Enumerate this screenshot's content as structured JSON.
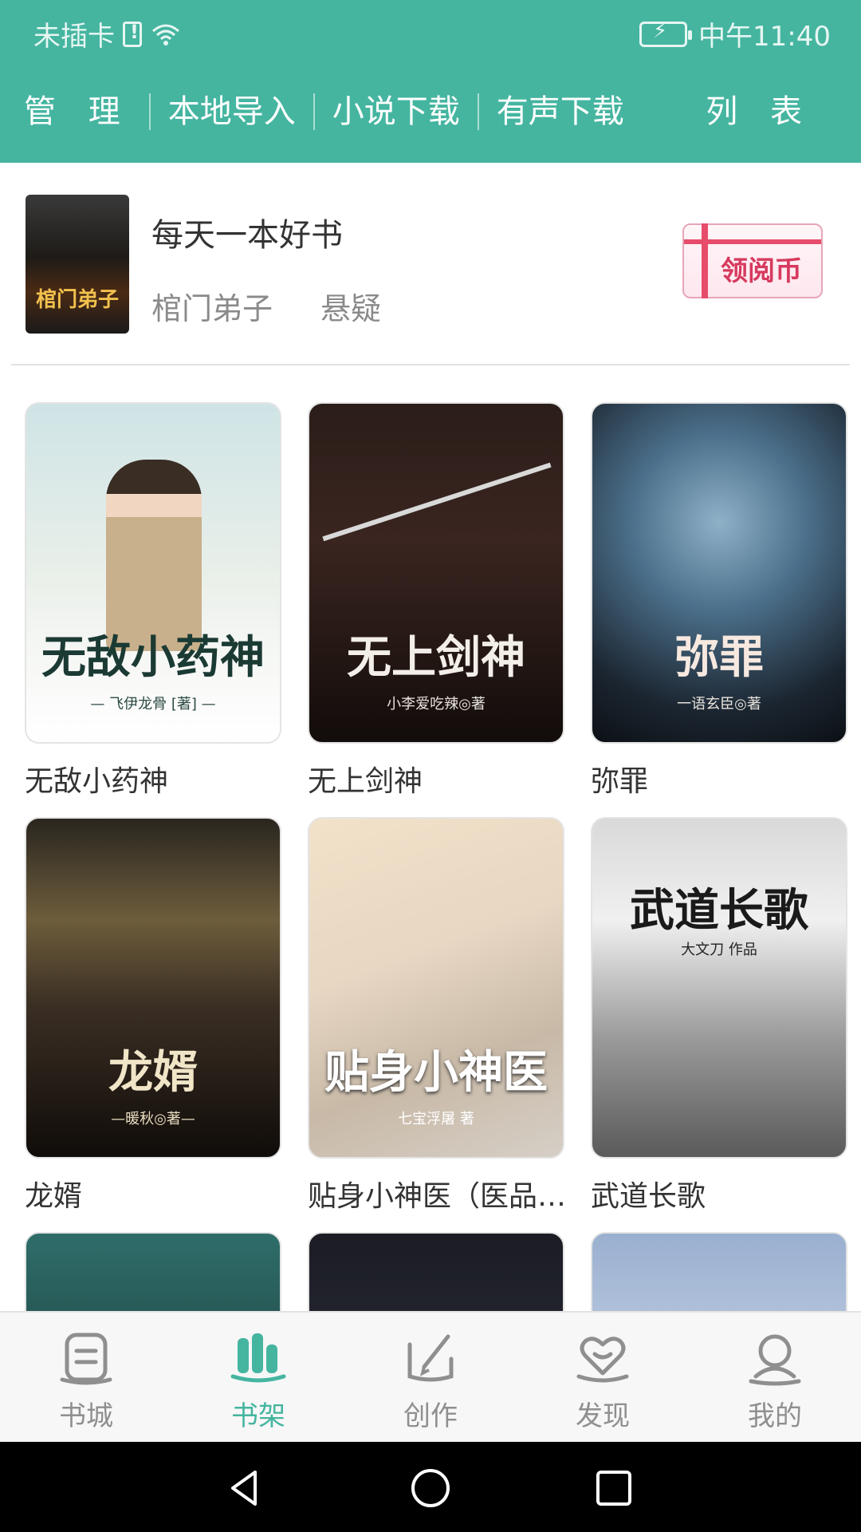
{
  "status_bar": {
    "carrier": "未插卡",
    "time": "中午11:40"
  },
  "top_nav": {
    "items": [
      "管 理",
      "本地导入",
      "小说下载",
      "有声下载"
    ],
    "list_label": "列 表"
  },
  "recommendation": {
    "heading": "每天一本好书",
    "book_title": "棺门弟子",
    "genre": "悬疑",
    "cover_text": "棺门弟子",
    "coin_button": "领阅币"
  },
  "books": [
    {
      "title": "无敌小药神",
      "cover_title": "无敌小药神",
      "cover_author": "— 飞伊龙骨 [著] —"
    },
    {
      "title": "无上剑神",
      "cover_title": "无上剑神",
      "cover_author": "小李爱吃辣◎著"
    },
    {
      "title": "弥罪",
      "cover_title": "弥罪",
      "cover_author": "一语玄臣◎著"
    },
    {
      "title": "龙婿",
      "cover_title": "龙婿",
      "cover_author": "—暖秋◎著—"
    },
    {
      "title": "贴身小神医（医品…",
      "cover_title": "贴身小神医",
      "cover_author": "七宝浮屠 著"
    },
    {
      "title": "武道长歌",
      "cover_title": "武道长歌",
      "cover_author": "大文刀 作品"
    }
  ],
  "bottom_nav": {
    "tabs": [
      {
        "label": "书城",
        "icon": "bookstore-icon"
      },
      {
        "label": "书架",
        "icon": "bookshelf-icon"
      },
      {
        "label": "创作",
        "icon": "create-icon"
      },
      {
        "label": "发现",
        "icon": "discover-icon"
      },
      {
        "label": "我的",
        "icon": "profile-icon"
      }
    ],
    "active_index": 1
  },
  "colors": {
    "accent": "#45b5a0",
    "inactive": "#8f8f8f"
  }
}
